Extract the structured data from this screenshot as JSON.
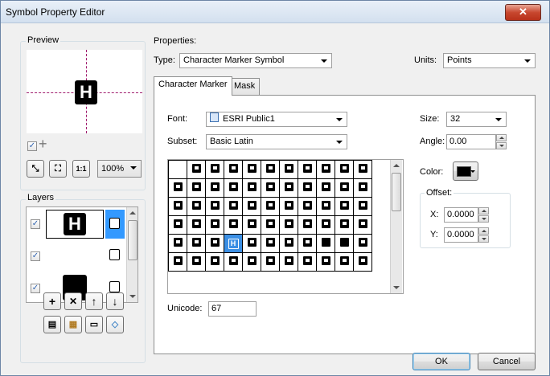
{
  "window": {
    "title": "Symbol Property Editor",
    "close_glyph": "✕"
  },
  "preview": {
    "label": "Preview",
    "symbol_char": "H",
    "zoom_value": "100%",
    "one_to_one": "1:1",
    "plus_glyph": "+",
    "check_glyph": "✓"
  },
  "layers": {
    "label": "Layers",
    "rows": [
      {
        "check": "✓",
        "symbol": "H",
        "selected": true
      },
      {
        "check": "✓",
        "symbol": "",
        "selected": false
      },
      {
        "check": "✓",
        "symbol": "",
        "selected": false
      }
    ],
    "buttons": {
      "add": "+",
      "remove": "✕",
      "up": "↑",
      "down": "↓"
    }
  },
  "properties": {
    "label": "Properties:",
    "type_label": "Type:",
    "type_value": "Character Marker Symbol",
    "units_label": "Units:",
    "units_value": "Points",
    "tabs": [
      {
        "label": "Character Marker",
        "active": true
      },
      {
        "label": "Mask",
        "active": false
      }
    ],
    "font_label": "Font:",
    "font_value": "ESRI Public1",
    "subset_label": "Subset:",
    "subset_value": "Basic Latin",
    "unicode_label": "Unicode:",
    "unicode_value": "67",
    "size_label": "Size:",
    "size_value": "32",
    "angle_label": "Angle:",
    "angle_value": "0.00",
    "color_label": "Color:",
    "color_value": "#000000",
    "offset_label": "Offset:",
    "x_label": "X:",
    "x_value": "0.0000",
    "y_label": "Y:",
    "y_value": "0.0000",
    "selected_glyph": "H"
  },
  "buttons": {
    "ok": "OK",
    "cancel": "Cancel"
  },
  "colors": {
    "selection": "#3b8fe4",
    "layer_highlight": "#3399ff"
  }
}
